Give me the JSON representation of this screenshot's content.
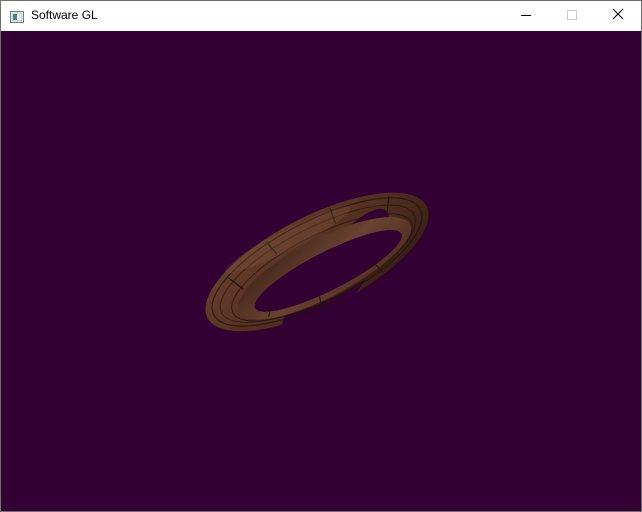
{
  "window": {
    "title": "Software GL",
    "icons": {
      "app": "app-window-icon",
      "minimize": "minimize-icon",
      "maximize": "maximize-icon",
      "close": "close-icon"
    }
  },
  "viewport": {
    "background_color": "#330033",
    "object": "textured-wooden-torus",
    "object_color": "#5a3424"
  }
}
